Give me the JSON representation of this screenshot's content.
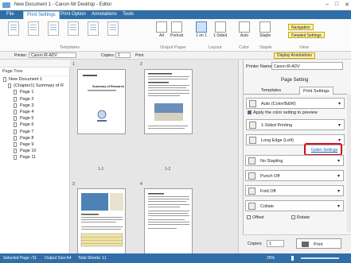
{
  "window": {
    "title": "New Document 1 - Canon iW Desktop - Editor"
  },
  "tabs": [
    {
      "label": "File"
    },
    {
      "label": "Print Settings"
    },
    {
      "label": "Print Option"
    },
    {
      "label": "Annotations"
    },
    {
      "label": "Tools"
    }
  ],
  "ribbon": {
    "groups": {
      "templates": "Templates",
      "output_paper": "Output Paper",
      "layout": "Layout",
      "color": "Color",
      "staple": "Staple",
      "view": "View"
    },
    "buttons": {
      "a4": "A4",
      "portrait": "Portrait",
      "on1": "1 on 1",
      "sided": "1-Sided",
      "auto": "Auto",
      "staple": "Staple"
    },
    "navigation": "Navigation",
    "detailed_settings": "Detailed Settings"
  },
  "toolbar2": {
    "printer_label": "Printer:",
    "printer_value": "Canon iR-ADV",
    "copies_label": "Copies:",
    "copies_value": "1",
    "print_label": "Print",
    "display_annotations": "Display Annotations"
  },
  "page_tree": {
    "header": "Page Tree",
    "items": [
      {
        "label": "New Document 1"
      },
      {
        "label": "(Chapter1) Summary of R"
      },
      {
        "label": "Page 1"
      },
      {
        "label": "Page 2"
      },
      {
        "label": "Page 3"
      },
      {
        "label": "Page 4"
      },
      {
        "label": "Page 5"
      },
      {
        "label": "Page 6"
      },
      {
        "label": "Page 7"
      },
      {
        "label": "Page 8"
      },
      {
        "label": "Page 9"
      },
      {
        "label": "Page 10"
      },
      {
        "label": "Page 11"
      }
    ]
  },
  "canvas": {
    "chapter_numbers": [
      "1",
      "2",
      "3",
      "4"
    ],
    "page_labels": [
      "1-1",
      "1-2"
    ],
    "page1_title": "Summary of Research"
  },
  "right_panel": {
    "printer_name_label": "Printer Name:",
    "printer_name_value": "Canon iR-ADV",
    "page_setting": "Page Setting",
    "tab_templates": "Templates",
    "tab_print_settings": "Print Settings",
    "color_mode": "Auto (Color/B&W)",
    "apply_color": "Apply the color setting to preview",
    "printing": "1-Sided Printing",
    "edge": "Long Edge (Left)",
    "gutter": "Gutter Settings",
    "stapling": "No Stapling",
    "punch": "Punch Off",
    "fold": "Fold Off",
    "collate": "Collate",
    "offset": "Offset",
    "rotate": "Rotate",
    "copies_label": "Copies:",
    "copies_value": "1",
    "print_button": "Print"
  },
  "statusbar": {
    "selected": "Selected Page: /11",
    "output_size": "Output Size:A4",
    "total": "Total Sheets: 11",
    "zoom": "25%"
  }
}
